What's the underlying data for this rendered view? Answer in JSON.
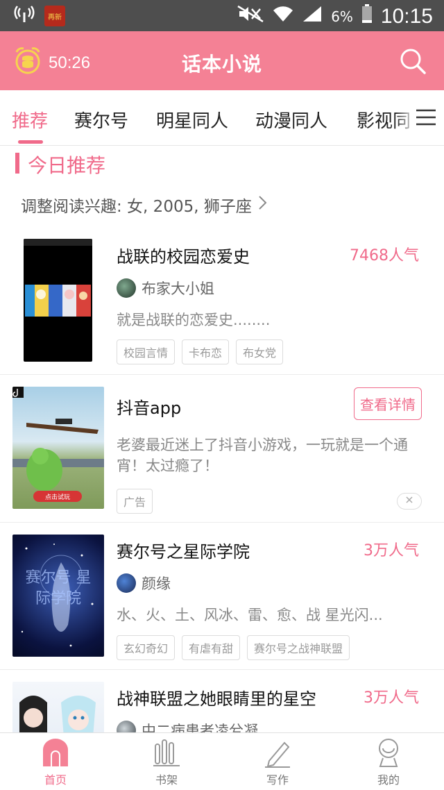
{
  "status_bar": {
    "battery": "6%",
    "time": "10:15",
    "app_icon_text": "再新"
  },
  "header": {
    "timer": "50:26",
    "title": "话本小说"
  },
  "tabs": [
    {
      "label": "推荐",
      "active": true
    },
    {
      "label": "赛尔号"
    },
    {
      "label": "明星同人"
    },
    {
      "label": "动漫同人"
    },
    {
      "label": "影视同"
    }
  ],
  "section": {
    "title": "今日推荐",
    "interest": "调整阅读兴趣: 女, 2005, 狮子座"
  },
  "books": [
    {
      "title": "战联的校园恋爱史",
      "popularity": "7468人气",
      "author": "布家大小姐",
      "desc": "就是战联的恋爱史........",
      "tags": [
        "校园言情",
        "卡布恋",
        "布女党"
      ]
    },
    {
      "title": "抖音app",
      "detail_button": "查看详情",
      "desc": "老婆最近迷上了抖音小游戏，一玩就是一个通宵！太过瘾了！",
      "tags": [
        "广告"
      ],
      "cover_button": "点击试玩"
    },
    {
      "title": "赛尔号之星际学院",
      "popularity": "3万人气",
      "author": "颜缘",
      "desc": "水、火、土、风冰、雷、愈、战 星光闪...",
      "tags": [
        "玄幻奇幻",
        "有虐有甜",
        "赛尔号之战神联盟"
      ],
      "cover_text": "赛尔号 星际学院"
    },
    {
      "title": "战神联盟之她眼睛里的星空",
      "popularity": "3万人气",
      "author": "中二病患者凌兮凝"
    }
  ],
  "bottom_nav": [
    {
      "label": "首页",
      "active": true
    },
    {
      "label": "书架"
    },
    {
      "label": "写作"
    },
    {
      "label": "我的"
    }
  ],
  "colors": {
    "header": "#f48195",
    "accent": "#f06a8a",
    "status_bar": "#4e4e4e"
  }
}
